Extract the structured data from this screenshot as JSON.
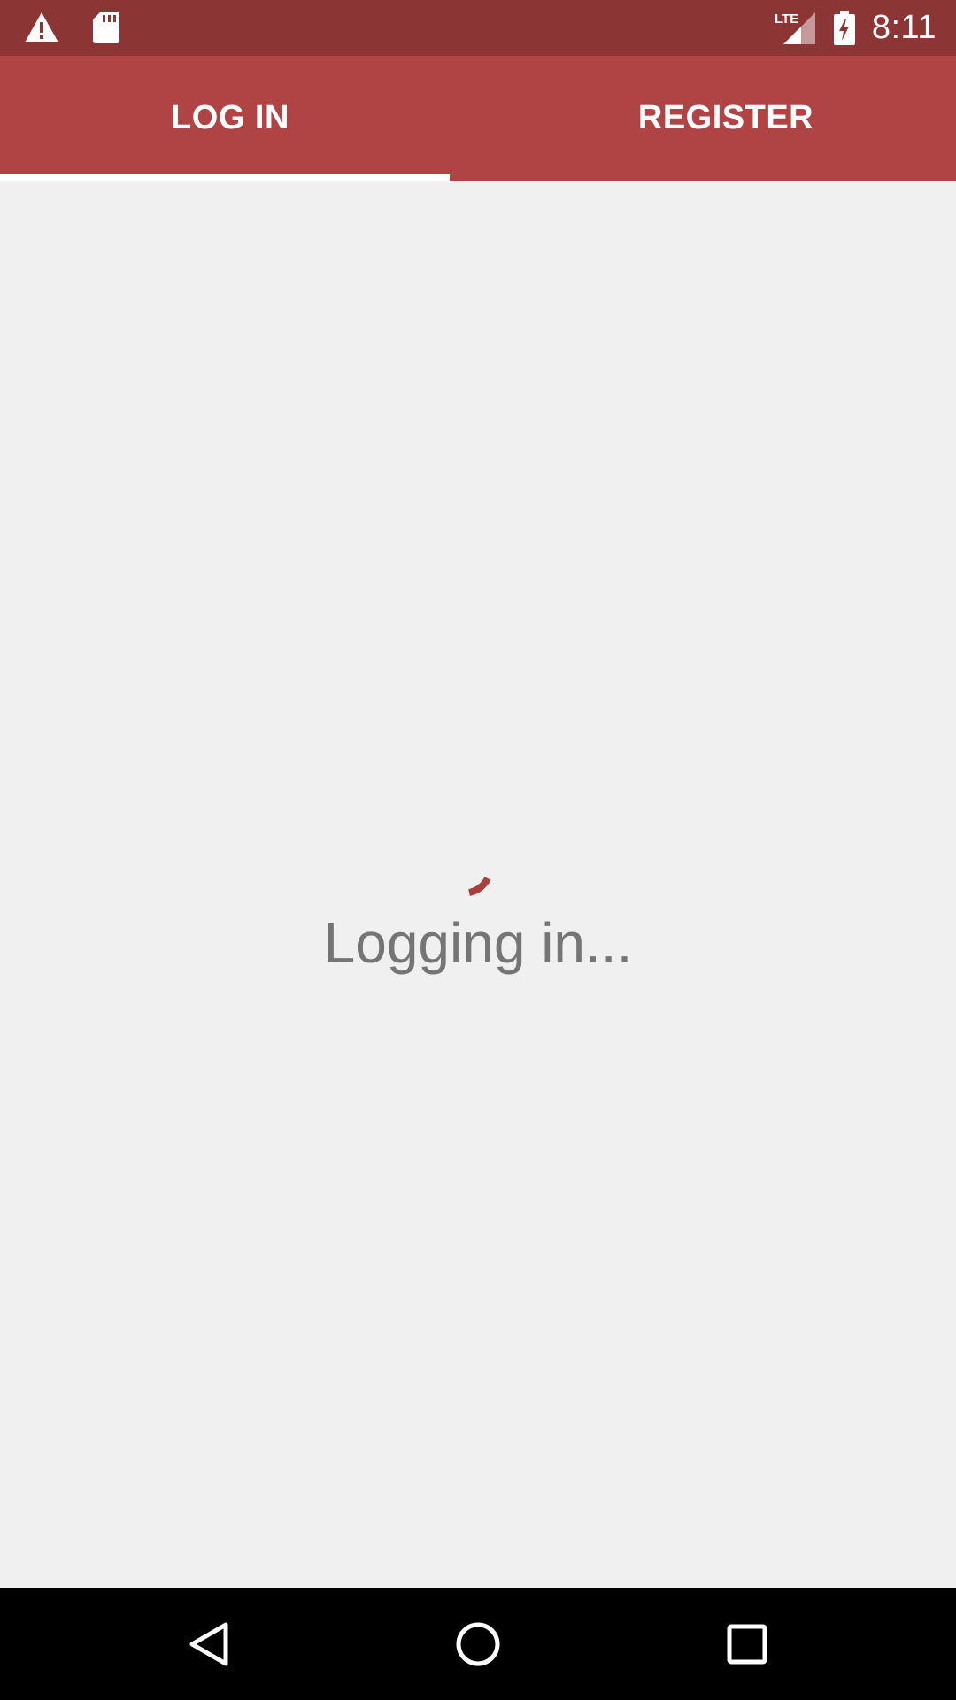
{
  "status_bar": {
    "time": "8:11",
    "network_label": "LTE",
    "left_icons": [
      "warning-icon",
      "sd-card-icon"
    ],
    "right_icons": [
      "signal-icon",
      "battery-charging-icon"
    ]
  },
  "tabs": [
    {
      "label": "LOG IN",
      "selected": true
    },
    {
      "label": "REGISTER",
      "selected": false
    }
  ],
  "content": {
    "loading_text": "Logging in..."
  },
  "nav_bar": {
    "icons": [
      "back-icon",
      "home-icon",
      "recents-icon"
    ]
  },
  "colors": {
    "status_bar": "#8c3535",
    "app_bar": "#b04445",
    "accent": "#a84040",
    "background": "#f0f0f0",
    "text_secondary": "#757575"
  }
}
